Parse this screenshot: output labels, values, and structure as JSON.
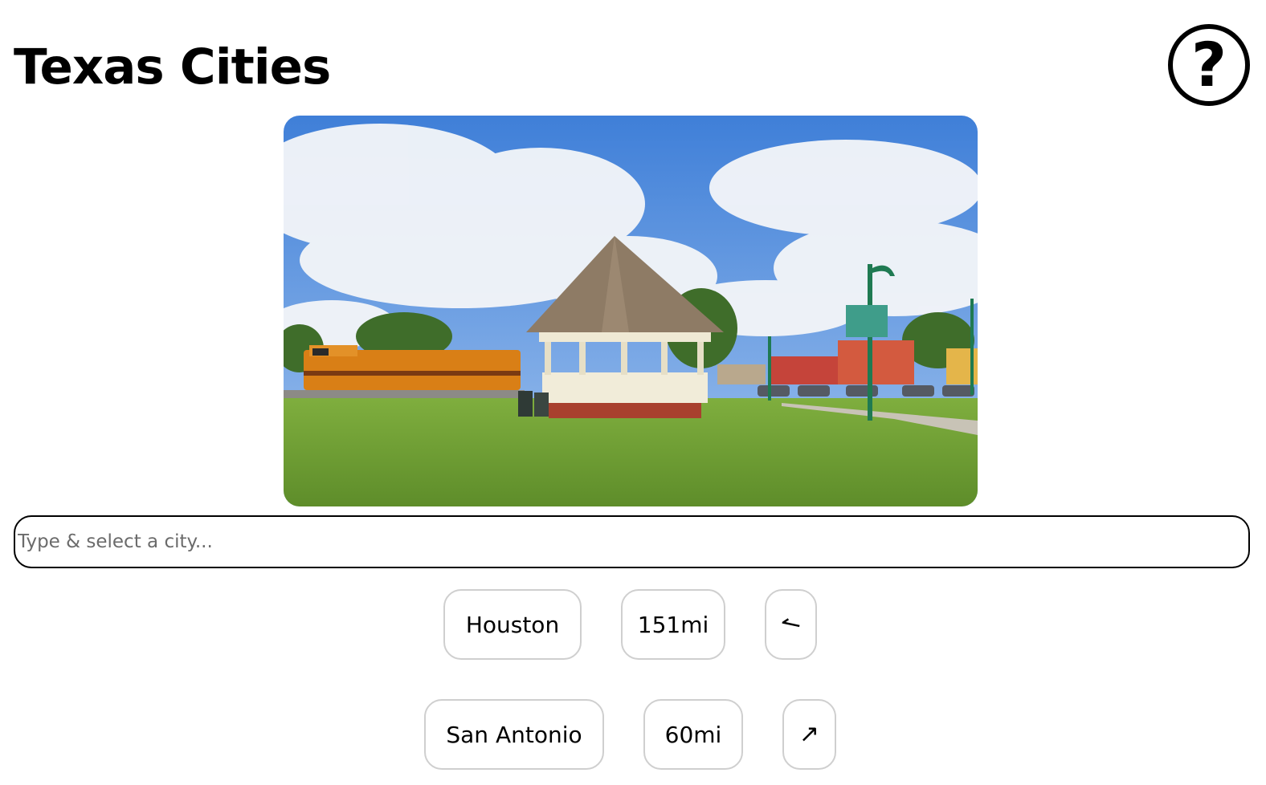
{
  "header": {
    "title": "Texas Cities",
    "help_icon": "help-circle-icon",
    "help_label": "?"
  },
  "photo": {
    "subject": "town-square-gazebo-photo",
    "colors": {
      "sky": "#5b93dd",
      "grass": "#6a9a30",
      "locomotive": "#d97f16",
      "lamp_post": "#1f7a52",
      "brick": "#c5443a"
    }
  },
  "search": {
    "placeholder": "Type & select a city...",
    "value": ""
  },
  "guesses": [
    {
      "city": "Houston",
      "distance": "151mi",
      "direction_icon": "arrow-left-icon",
      "direction": "↼"
    },
    {
      "city": "San Antonio",
      "distance": "60mi",
      "direction_icon": "arrow-up-right-icon",
      "direction": "↗"
    }
  ]
}
